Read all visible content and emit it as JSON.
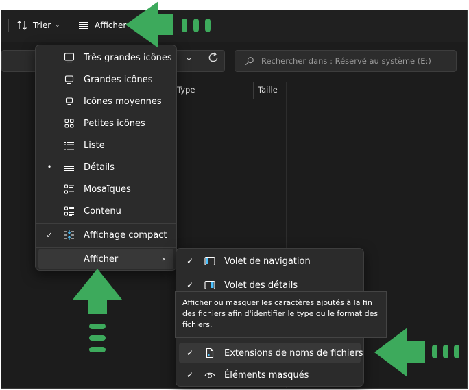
{
  "toolbar": {
    "sort_label": "Trier",
    "view_label": "Afficher"
  },
  "address": {
    "search_placeholder": "Rechercher dans : Réservé au système (E:)"
  },
  "columns": [
    {
      "label": "Type"
    },
    {
      "label": "Taille"
    }
  ],
  "view_menu": {
    "items": [
      {
        "label": "Très grandes icônes",
        "icon": "extra-large-icons-icon",
        "mark": ""
      },
      {
        "label": "Grandes icônes",
        "icon": "large-icons-icon",
        "mark": ""
      },
      {
        "label": "Icônes moyennes",
        "icon": "medium-icons-icon",
        "mark": ""
      },
      {
        "label": "Petites icônes",
        "icon": "small-icons-icon",
        "mark": ""
      },
      {
        "label": "Liste",
        "icon": "list-icon",
        "mark": ""
      },
      {
        "label": "Détails",
        "icon": "details-icon",
        "mark": "•"
      },
      {
        "label": "Mosaïques",
        "icon": "tiles-icon",
        "mark": ""
      },
      {
        "label": "Contenu",
        "icon": "content-icon",
        "mark": ""
      }
    ],
    "compact": {
      "label": "Affichage compact",
      "icon": "compact-view-icon",
      "mark": "✓"
    },
    "show": {
      "label": "Afficher",
      "arrow": "›"
    }
  },
  "show_submenu": {
    "items": [
      {
        "label": "Volet de navigation",
        "icon": "navigation-pane-icon",
        "mark": "✓"
      },
      {
        "label": "Volet des détails",
        "icon": "details-pane-icon",
        "mark": "✓"
      },
      {
        "label": "Extensions de noms de fichiers",
        "icon": "file-extension-icon",
        "mark": "✓"
      },
      {
        "label": "Éléments masqués",
        "icon": "eye-icon",
        "mark": "✓"
      }
    ]
  },
  "tooltip": {
    "text": "Afficher ou masquer les caractères ajoutés à la fin des fichiers afin d'identifier le type ou le format des fichiers."
  },
  "colors": {
    "background": "#1c1c1c",
    "menu": "#2b2b2b",
    "highlight": "#383838",
    "annotation_arrow": "#3daa5c",
    "accent_icon": "#4cc2ff"
  }
}
